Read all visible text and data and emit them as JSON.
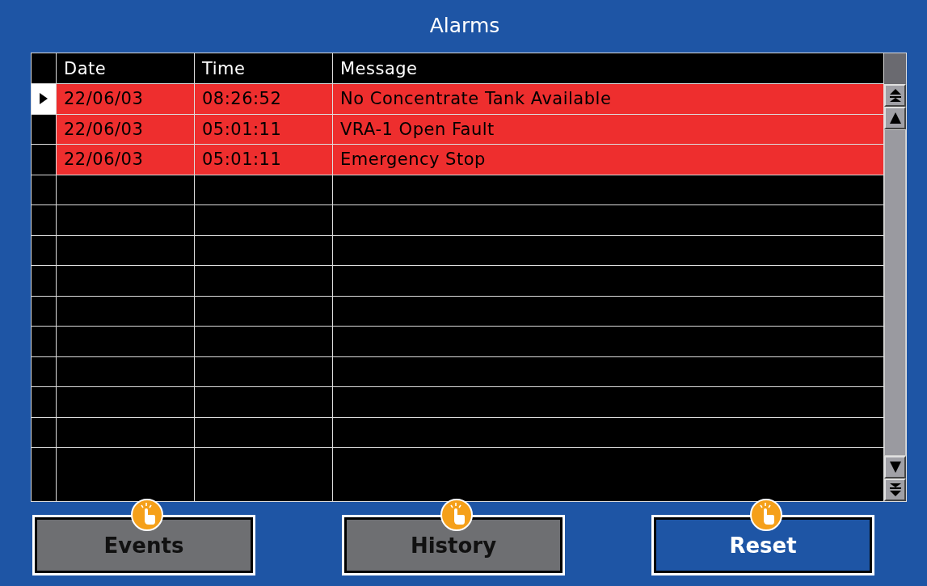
{
  "window": {
    "title": "Alarms"
  },
  "table": {
    "columns": [
      "Date",
      "Time",
      "Message"
    ],
    "rows": [
      {
        "selected": true,
        "active": true,
        "cells": [
          "22/06/03",
          "08:26:52",
          "No Concentrate Tank Available"
        ]
      },
      {
        "selected": false,
        "active": true,
        "cells": [
          "22/06/03",
          "05:01:11",
          "VRA-1 Open Fault"
        ]
      },
      {
        "selected": false,
        "active": true,
        "cells": [
          "22/06/03",
          "05:01:11",
          "Emergency Stop"
        ]
      }
    ]
  },
  "buttons": [
    {
      "label": "Events",
      "selected": false
    },
    {
      "label": "History",
      "selected": false
    },
    {
      "label": "Reset",
      "selected": true
    }
  ]
}
